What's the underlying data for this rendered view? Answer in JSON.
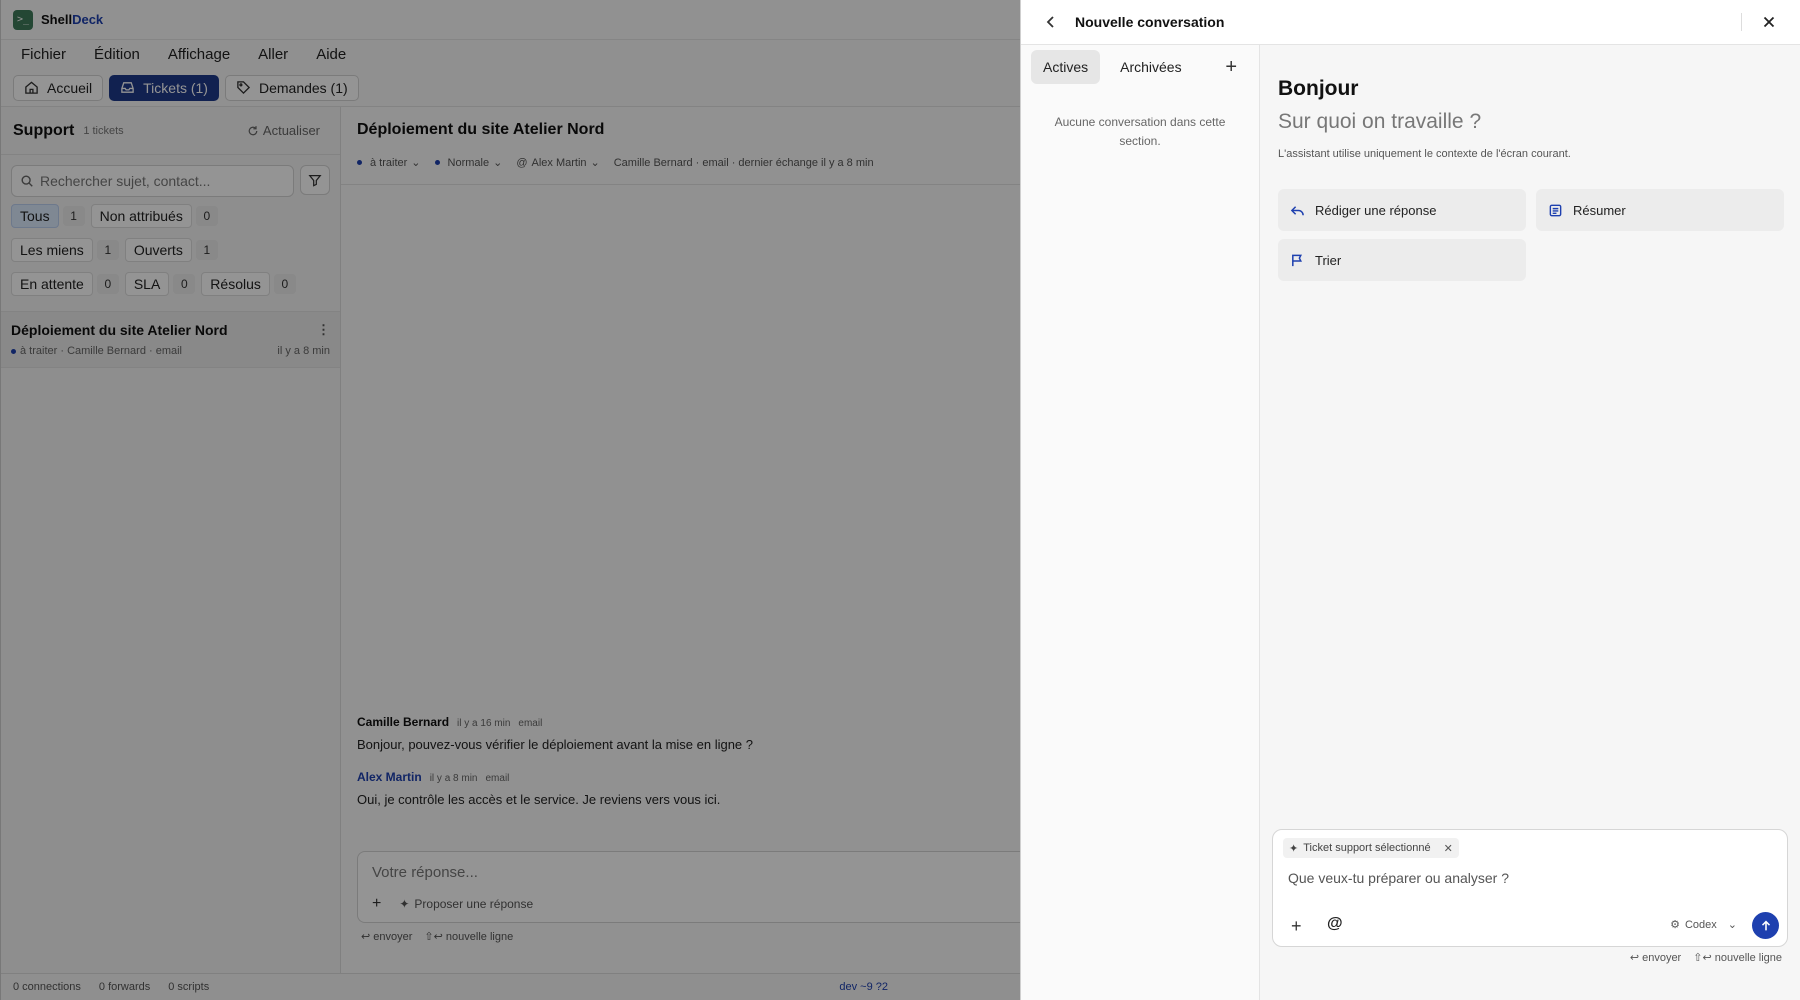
{
  "app": {
    "name_part1": "Shell",
    "name_part2": "Deck"
  },
  "menu": [
    "Fichier",
    "Édition",
    "Affichage",
    "Aller",
    "Aide"
  ],
  "toolbar": {
    "home_label": "Accueil",
    "tickets_label": "Tickets (1)",
    "requests_label": "Demandes (1)"
  },
  "support": {
    "title": "Support",
    "count": "1 tickets",
    "refresh_label": "Actualiser",
    "search_placeholder": "Rechercher sujet, contact...",
    "filters": [
      {
        "label": "Tous",
        "count": "1"
      },
      {
        "label": "Non attribués",
        "count": "0"
      },
      {
        "label": "Les miens",
        "count": "1"
      },
      {
        "label": "Ouverts",
        "count": "1"
      },
      {
        "label": "En attente",
        "count": "0"
      },
      {
        "label": "SLA",
        "count": "0"
      },
      {
        "label": "Résolus",
        "count": "0"
      }
    ],
    "ticket": {
      "title": "Déploiement du site Atelier Nord",
      "status": "à traiter",
      "meta": "· Camille Bernard · email",
      "time": "il y a 8 min"
    }
  },
  "conversation": {
    "title": "Déploiement du site Atelier Nord",
    "status": "à traiter",
    "priority": "Normale",
    "assignee": "Alex Martin",
    "meta": "Camille Bernard · email · dernier échange il y a 8 min",
    "messages": [
      {
        "author": "Camille Bernard",
        "time": "il y a 16 min",
        "channel": "email",
        "text": "Bonjour, pouvez-vous vérifier le déploiement avant la mise en ligne ?"
      },
      {
        "author": "Alex Martin",
        "time": "il y a 8 min",
        "channel": "email",
        "text": "Oui, je contrôle les accès et le service. Je reviens vers vous ici."
      }
    ],
    "reply_placeholder": "Votre réponse...",
    "propose_label": "Proposer une réponse",
    "hint_send": "↩ envoyer",
    "hint_newline": "⇧↩ nouvelle ligne"
  },
  "statusbar": {
    "connections": "0 connections",
    "forwards": "0 forwards",
    "scripts": "0 scripts",
    "branch": "dev ~9 ?2"
  },
  "panel": {
    "title": "Nouvelle conversation",
    "tab_active": "Actives",
    "tab_archived": "Archivées",
    "empty_text": "Aucune conversation dans cette section.",
    "greeting": "Bonjour",
    "question": "Sur quoi on travaille ?",
    "note": "L'assistant utilise uniquement le contexte de l'écran courant.",
    "actions": {
      "reply": "Rédiger une réponse",
      "summarize": "Résumer",
      "sort": "Trier"
    },
    "context_chip": "Ticket support sélectionné",
    "composer_placeholder": "Que veux-tu préparer ou analyser ?",
    "model": "Codex",
    "hint_send": "↩ envoyer",
    "hint_newline": "⇧↩ nouvelle ligne"
  },
  "colors": {
    "accent": "#1e40af",
    "overlay_dim": "rgba(0,0,0,0.42)"
  }
}
